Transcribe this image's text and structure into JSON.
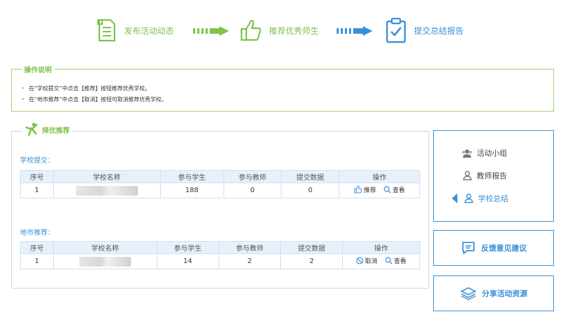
{
  "steps": {
    "step1": {
      "label": "发布活动动态",
      "icon": "document-icon"
    },
    "step2": {
      "label": "推荐优秀师生",
      "icon": "thumbs-up-icon"
    },
    "step3": {
      "label": "提交总结报告",
      "icon": "clipboard-check-icon"
    }
  },
  "instructions": {
    "title": "操作说明",
    "items": [
      "在“学校提交”中点击【推荐】按钮推荐优秀学校。",
      "在“地市推荐”中点击【取消】按钮可取消推荐优秀学校。"
    ]
  },
  "main": {
    "title": "择优推荐",
    "school_section": {
      "label": "学校提交：",
      "headers": [
        "序号",
        "学校名称",
        "参与学生",
        "参与教师",
        "提交数据",
        "操作"
      ],
      "rows": [
        {
          "no": "1",
          "students": "188",
          "teachers": "0",
          "data": "0",
          "op1": "推荐",
          "op2": "查看"
        }
      ]
    },
    "city_section": {
      "label": "地市推荐：",
      "headers": [
        "序号",
        "学校名称",
        "参与学生",
        "参与教师",
        "提交数据",
        "操作"
      ],
      "rows": [
        {
          "no": "1",
          "students": "14",
          "teachers": "2",
          "data": "2",
          "op1": "取消",
          "op2": "查看"
        }
      ]
    }
  },
  "side": {
    "items": [
      {
        "label": "活动小组",
        "icon": "group-icon"
      },
      {
        "label": "教师报告",
        "icon": "user-icon"
      },
      {
        "label": "学校总结",
        "icon": "user-icon"
      }
    ],
    "feedback_label": "反馈意见建议",
    "share_label": "分享活动资源"
  },
  "colors": {
    "green": "#7dc24b",
    "blue": "#3a90d8"
  }
}
